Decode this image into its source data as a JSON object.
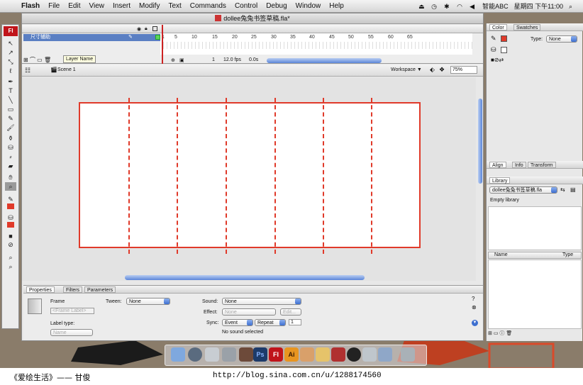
{
  "menubar": {
    "items": [
      {
        "label": "Flash",
        "app": true
      },
      {
        "label": "File"
      },
      {
        "label": "Edit"
      },
      {
        "label": "View"
      },
      {
        "label": "Insert"
      },
      {
        "label": "Modify"
      },
      {
        "label": "Text"
      },
      {
        "label": "Commands"
      },
      {
        "label": "Control"
      },
      {
        "label": "Debug"
      },
      {
        "label": "Window"
      },
      {
        "label": "Help"
      }
    ],
    "input_method": "智能ABC",
    "clock": "星期四 下午11:00"
  },
  "window": {
    "title": "dollee兔兔书签草稿.fla*"
  },
  "timeline": {
    "layer_name": "尺寸辅助",
    "tooltip": "Layer Name",
    "frame_ticks": [
      "1",
      "5",
      "10",
      "15",
      "20",
      "25",
      "30",
      "35",
      "40",
      "45",
      "50",
      "55",
      "60",
      "65"
    ],
    "current_frame": "1",
    "fps": "12.0 fps",
    "time": "0.0s"
  },
  "editbar": {
    "scene": "Scene 1",
    "workspace": "Workspace ▼",
    "zoom": "75%"
  },
  "properties": {
    "tabs": [
      "Properties",
      "Filters",
      "Parameters"
    ],
    "frame_label": "Frame",
    "frame_placeholder": "<Frame Label>",
    "label_type_label": "Label type:",
    "label_type_value": "Name",
    "tween_label": "Tween:",
    "tween_value": "None",
    "sound_label": "Sound:",
    "sound_value": "None",
    "effect_label": "Effect:",
    "effect_value": "None",
    "edit_button": "Edit...",
    "sync_label": "Sync:",
    "sync_value": "Event",
    "repeat_value": "Repeat",
    "repeat_count": "1",
    "no_sound": "No sound selected"
  },
  "color_panel": {
    "tabs": [
      "Color",
      "Swatches"
    ],
    "type_label": "Type:",
    "type_value": "None"
  },
  "align_panel": {
    "tabs": [
      "Align",
      "Info",
      "Transform"
    ]
  },
  "library_panel": {
    "tab": "Library",
    "document": "dollee兔兔书签草稿.fla",
    "empty_text": "Empty library",
    "col_name": "Name",
    "col_type": "Type"
  },
  "caption": {
    "left": "《爱绘生活》—— 甘俊",
    "right": "http://blog.sina.com.cn/u/1288174560"
  },
  "colors": {
    "stage_border": "#e03a2a",
    "selection_blue": "#5a7fc3",
    "flash_red": "#c0141a"
  },
  "dock": {
    "items": [
      "finder-icon",
      "safari-icon",
      "mail-icon",
      "photoshop-icon",
      "flash-icon",
      "illustrator-icon",
      "qq-icon",
      "trash-icon"
    ],
    "labels": {
      "ps": "Ps",
      "fl": "Fl",
      "ai": "Ai"
    }
  },
  "tools": {
    "logo": "Fl"
  }
}
